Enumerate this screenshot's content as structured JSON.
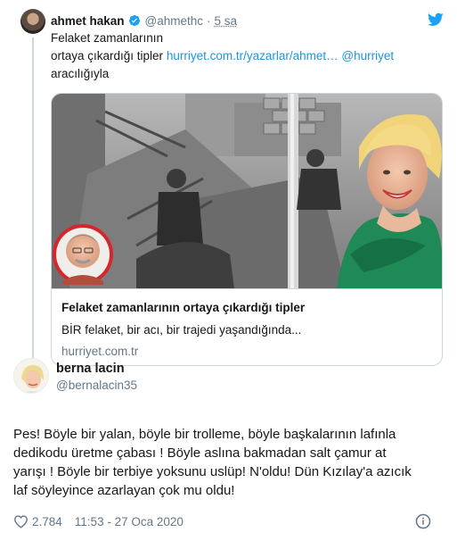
{
  "parent_tweet": {
    "author_name": "ahmet hakan",
    "author_handle": "@ahmethc",
    "separator": "·",
    "time": "5 sa",
    "text_line1": "Felaket zamanlarının",
    "text_line2_prefix": "ortaya çıkardığı tipler ",
    "link_url": "hurriyet.com.tr/yazarlar/ahmet…",
    "mention": "@hurriyet",
    "text_line3": "aracılığıyla",
    "card": {
      "title": "Felaket zamanlarının ortaya çıkardığı tipler",
      "description": "BİR felaket, bir acı, bir trajedi yaşandığında...",
      "domain": "hurriyet.com.tr"
    }
  },
  "main_tweet": {
    "author_name": "berna lacin",
    "author_handle": "@bernalacin35",
    "text_lines": [
      "Pes! Böyle bir yalan, böyle bir trolleme, böyle başkalarının lafınla",
      "dedikodu üretme çabası ! Böyle aslına bakmadan salt çamur at",
      "yarışı ! Böyle bir terbiye yoksunu uslüp! N'oldu! Dün Kızılay'a azıcık",
      "laf söyleyince azarlayan çok mu oldu!"
    ],
    "likes": "2.784",
    "timestamp": "11:53 - 27 Oca 2020"
  },
  "icons": {
    "verified": "verified-badge-icon",
    "twitter": "twitter-bird-icon",
    "like": "heart-icon",
    "info": "info-icon"
  },
  "colors": {
    "link": "#1b95e0",
    "secondary_text": "#657786",
    "border": "#ccd6dd",
    "verified": "#1da1f2",
    "card_accent_red": "#d7262b",
    "green_dress": "#1f8a56"
  }
}
